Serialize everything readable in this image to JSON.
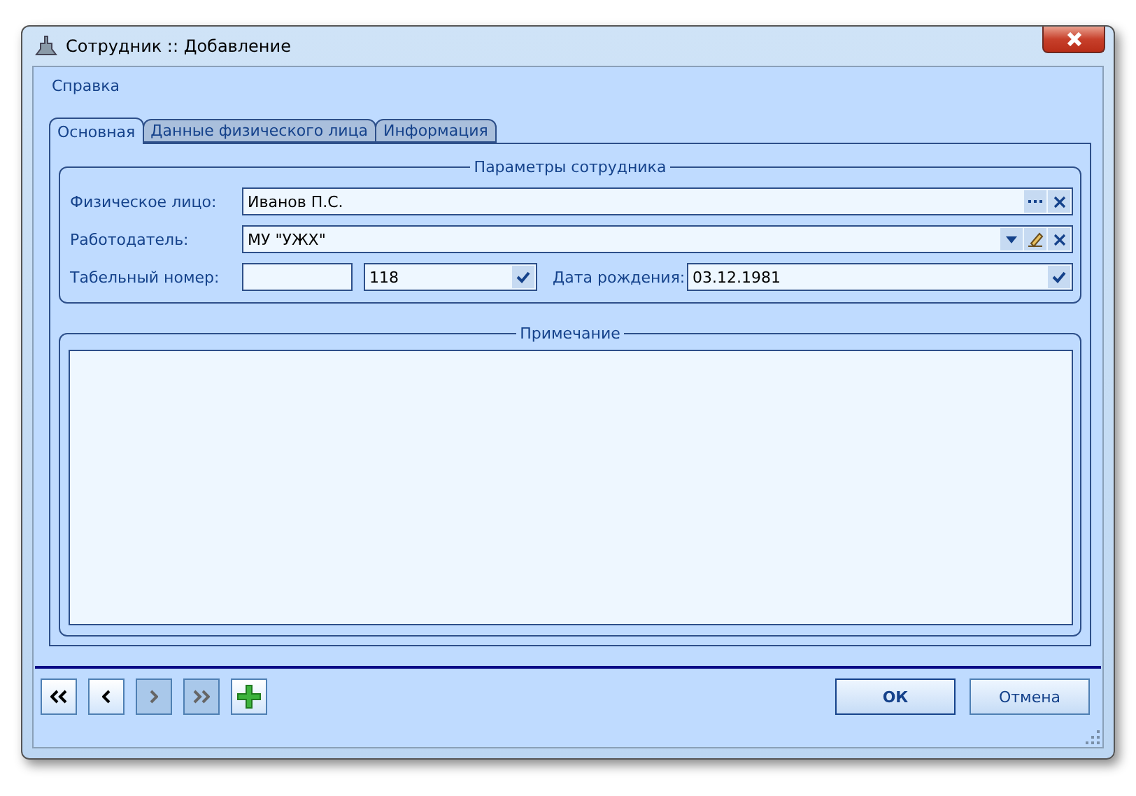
{
  "window": {
    "title": "Сотрудник :: Добавление"
  },
  "menu": [
    "Справка"
  ],
  "tabs": [
    {
      "label": "Основная",
      "selected": true
    },
    {
      "label": "Данные физического лица",
      "selected": false
    },
    {
      "label": "Информация",
      "selected": false
    }
  ],
  "params": {
    "title": "Параметры сотрудника",
    "person": {
      "label": "Физическое лицо:",
      "value": "Иванов П.С."
    },
    "employer": {
      "label": "Работодатель:",
      "value": "МУ \"УЖХ\""
    },
    "tab_number": {
      "label": "Табельный номер:",
      "combo": "118"
    },
    "birth_date": {
      "label": "Дата рождения:",
      "value": "03.12.1981"
    }
  },
  "note": {
    "title": "Примечание"
  },
  "nav_buttons": [
    {
      "kind": "first",
      "disabled": false
    },
    {
      "kind": "prev",
      "disabled": false
    },
    {
      "kind": "next",
      "disabled": true
    },
    {
      "kind": "last",
      "disabled": true
    },
    {
      "kind": "add",
      "disabled": false
    }
  ],
  "buttons": [
    {
      "label": "ОК",
      "default": true
    },
    {
      "label": "Отмена",
      "default": false
    }
  ]
}
